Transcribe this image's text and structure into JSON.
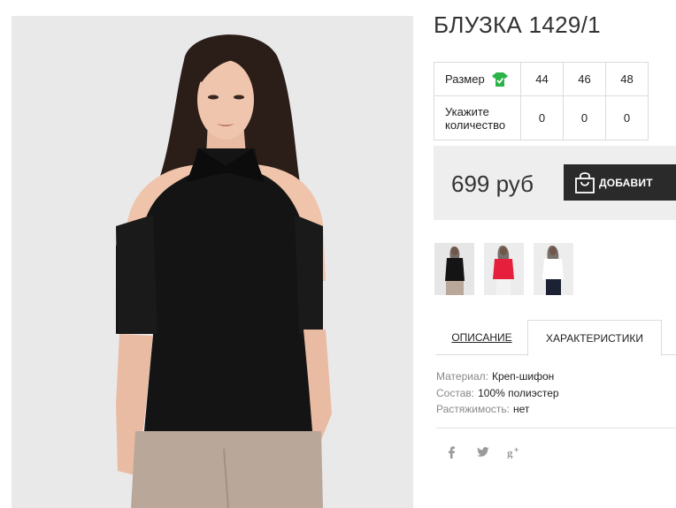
{
  "product": {
    "title": "БЛУЗКА 1429/1",
    "price": "699 руб",
    "add_to_cart_label": "ДОБАВИТ"
  },
  "size_table": {
    "size_label": "Размер",
    "qty_label_line1": "Укажите",
    "qty_label_line2": "количество",
    "sizes": [
      "44",
      "46",
      "48"
    ],
    "quantities": [
      "0",
      "0",
      "0"
    ]
  },
  "tabs": [
    {
      "label": "ОПИСАНИЕ",
      "active": false
    },
    {
      "label": "ХАРАКТЕРИСТИКИ",
      "active": true
    }
  ],
  "characteristics": [
    {
      "key": "Материал:",
      "value": "Креп-шифон"
    },
    {
      "key": "Состав:",
      "value": "100% полиэстер"
    },
    {
      "key": "Растяжимость:",
      "value": "нет"
    }
  ],
  "social": [
    {
      "icon": "facebook-icon",
      "glyph": "f"
    },
    {
      "icon": "twitter-icon",
      "glyph": "🐦"
    },
    {
      "icon": "google-plus-icon",
      "glyph": "g+"
    }
  ],
  "colors": {
    "accent_dark": "#2a2a2a",
    "price_bg": "#eeeeee",
    "size_icon_green": "#2bb34a"
  }
}
